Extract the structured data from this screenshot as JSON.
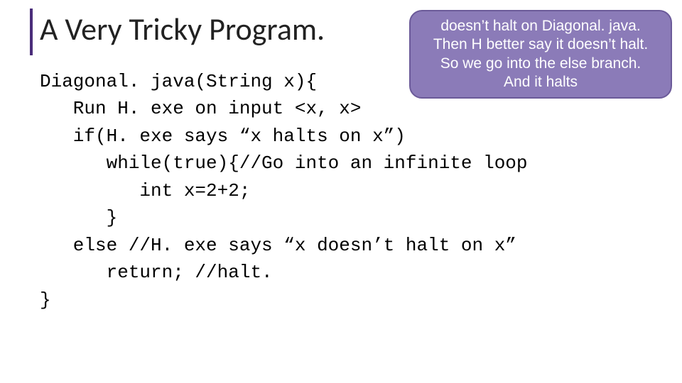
{
  "title": "A Very Tricky Program.",
  "code": {
    "l1": "Diagonal. java(String x){",
    "l2": "   Run H. exe on input <x, x>",
    "l3": "   if(H. exe says “x halts on x”)",
    "l4": "      while(true){//Go into an infinite loop",
    "l5": "         int x=2+2;",
    "l6": "      }",
    "l7": "   else //H. exe says “x doesn’t halt on x”",
    "l8": "      return; //halt.",
    "l9": "}"
  },
  "callout": {
    "line1": "doesn’t halt on Diagonal. java.",
    "line2": "Then H better say it doesn’t halt.",
    "line3": "So we go into the else branch.",
    "line4": "And it halts"
  }
}
